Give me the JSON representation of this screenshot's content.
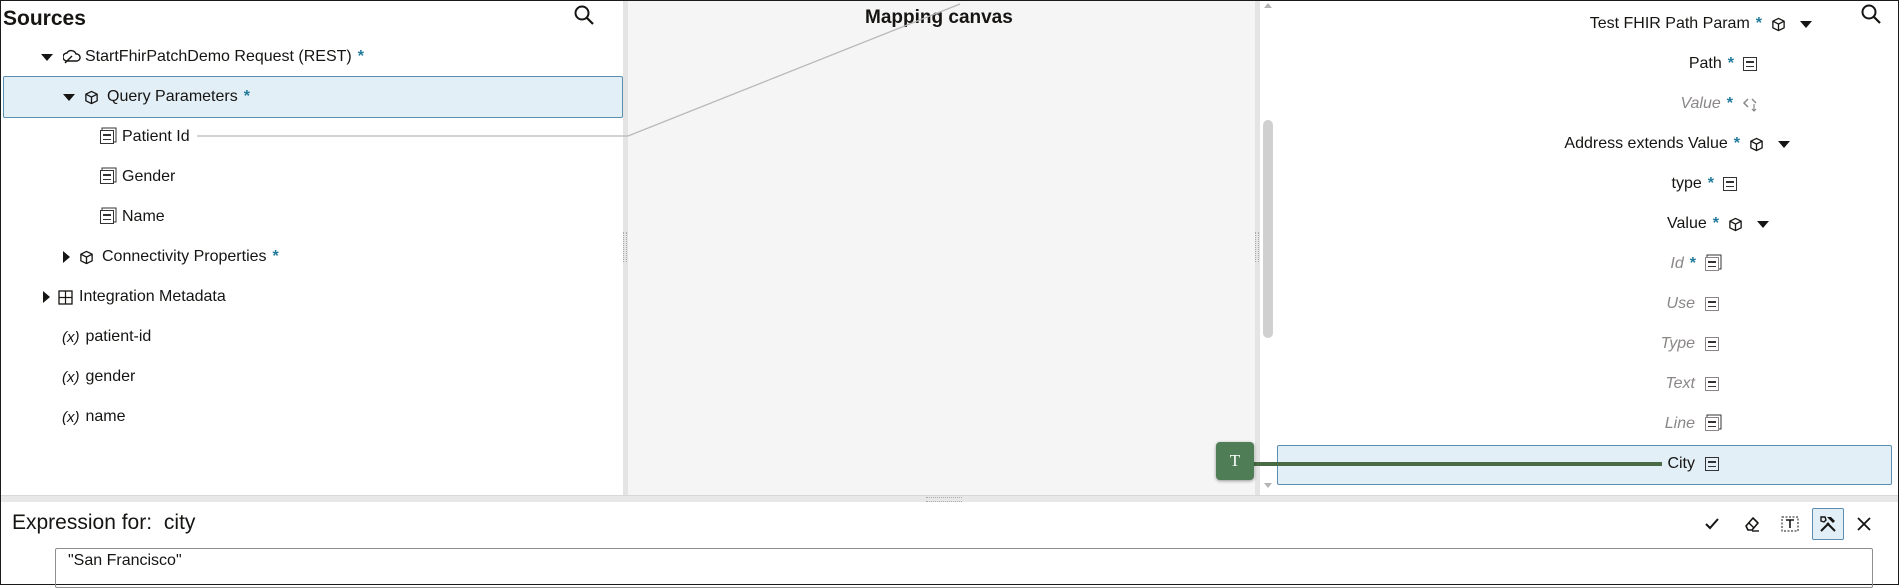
{
  "sources": {
    "title": "Sources",
    "request": {
      "label": "StartFhirPatchDemo Request (REST)",
      "required": "*"
    },
    "query_params": {
      "label": "Query Parameters",
      "required": "*"
    },
    "fields": [
      "Patient Id",
      "Gender",
      "Name"
    ],
    "connectivity": {
      "label": "Connectivity Properties",
      "required": "*"
    },
    "integration_metadata": "Integration Metadata",
    "variables": [
      {
        "prefix": "(x)",
        "name": "patient-id"
      },
      {
        "prefix": "(x)",
        "name": "gender"
      },
      {
        "prefix": "(x)",
        "name": "name"
      }
    ]
  },
  "canvas": {
    "title": "Mapping canvas",
    "node_label": "T"
  },
  "target": {
    "rows": [
      {
        "label": "Test FHIR Path Param",
        "required": "*"
      },
      {
        "label": "Path",
        "required": "*"
      },
      {
        "label": "Value",
        "required": "*"
      },
      {
        "label": "Address extends Value",
        "required": "*"
      },
      {
        "label": "type",
        "required": "*"
      },
      {
        "label": "Value",
        "required": "*"
      },
      {
        "label": "Id",
        "required": "*"
      },
      {
        "label": "Use"
      },
      {
        "label": "Type"
      },
      {
        "label": "Text"
      },
      {
        "label": "Line"
      },
      {
        "label": "City"
      }
    ]
  },
  "expression": {
    "label": "Expression for:",
    "target_name": "city",
    "value": "\"San Francisco\""
  },
  "colors": {
    "accent": "#227a9b",
    "selected_bg": "#e3eff7",
    "node_green": "#4f7d55"
  }
}
